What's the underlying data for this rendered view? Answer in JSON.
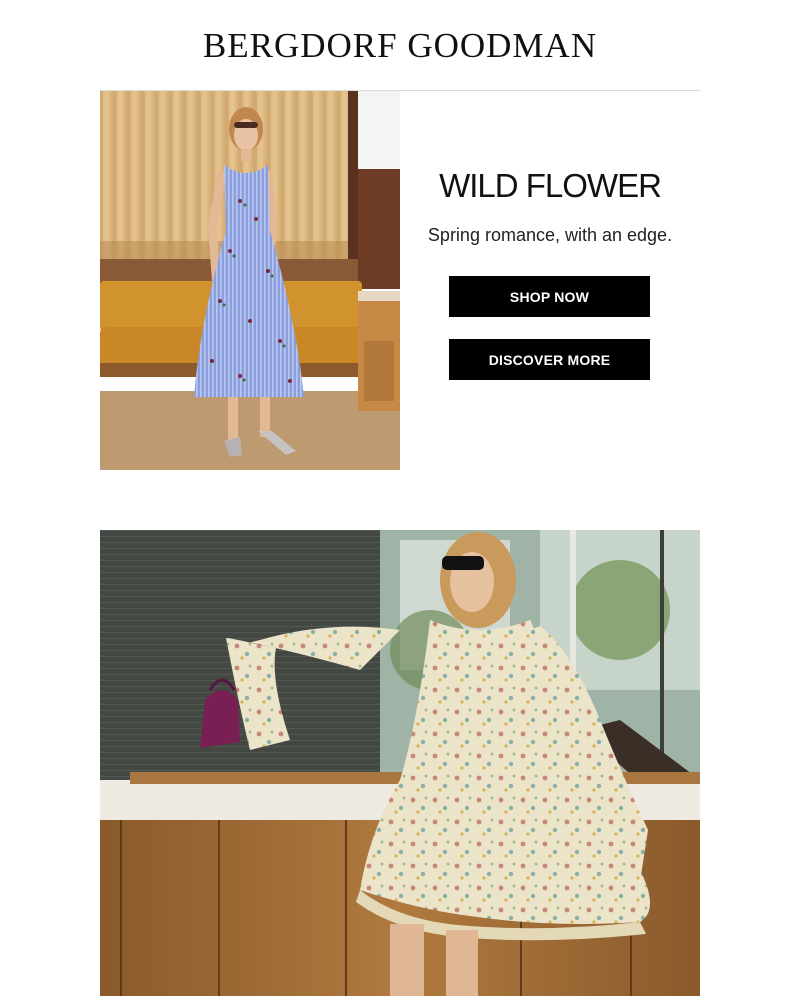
{
  "header": {
    "brand": "BERGDORF GOODMAN"
  },
  "promo": {
    "headline": "WILD FLOWER",
    "subhead": "Spring romance, with an edge.",
    "primary_button": "SHOP NOW",
    "secondary_button": "DISCOVER MORE"
  },
  "colors": {
    "button_bg": "#000000",
    "button_text": "#ffffff",
    "divider": "#d9d9d9"
  }
}
